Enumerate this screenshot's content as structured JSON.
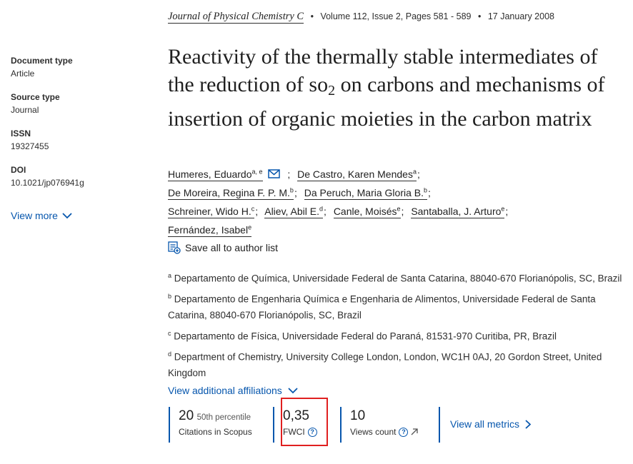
{
  "header": {
    "journal": "Journal of Physical Chemistry C",
    "volume_info": "Volume 112, Issue 2, Pages 581 - 589",
    "date": "17 January 2008",
    "separator": "•"
  },
  "sidebar": {
    "doc_type_label": "Document type",
    "doc_type_value": "Article",
    "source_type_label": "Source type",
    "source_type_value": "Journal",
    "issn_label": "ISSN",
    "issn_value": "19327455",
    "doi_label": "DOI",
    "doi_value": "10.1021/jp076941g",
    "view_more": "View more"
  },
  "title": {
    "part1": "Reactivity of the thermally stable intermediates of the reduction of so",
    "sub": "2",
    "part2": " on carbons and mechanisms of insertion of organic moieties in the carbon matrix"
  },
  "authors": [
    {
      "name": "Humeres, Eduardo",
      "sup": "a, e",
      "email": true
    },
    {
      "name": "De Castro, Karen Mendes",
      "sup": "a"
    },
    {
      "name": "De Moreira, Regina F. P. M.",
      "sup": "b"
    },
    {
      "name": "Da Peruch, Maria Gloria B.",
      "sup": "b"
    },
    {
      "name": "Schreiner, Wido H.",
      "sup": "c"
    },
    {
      "name": "Aliev, Abil E.",
      "sup": "d"
    },
    {
      "name": "Canle, Moisés",
      "sup": "e"
    },
    {
      "name": "Santaballa, J. Arturo",
      "sup": "e"
    },
    {
      "name": "Fernández, Isabel",
      "sup": "e"
    }
  ],
  "author_separator": ";",
  "save_authors": "Save all to author list",
  "affiliations": [
    {
      "sup": "a",
      "text": "Departamento de Química, Universidade Federal de Santa Catarina, 88040-670 Florianópolis, SC, Brazil"
    },
    {
      "sup": "b",
      "text": "Departamento de Engenharia Química e Engenharia de Alimentos, Universidade Federal de Santa Catarina, 88040-670 Florianópolis, SC, Brazil"
    },
    {
      "sup": "c",
      "text": "Departamento de Física, Universidade Federal do Paraná, 81531-970 Curitiba, PR, Brazil"
    },
    {
      "sup": "d",
      "text": "Department of Chemistry, University College London, London, WC1H 0AJ, 20 Gordon Street, United Kingdom"
    }
  ],
  "view_affiliations": "View additional affiliations",
  "metrics": {
    "citations_num": "20",
    "citations_percentile": "50th percentile",
    "citations_label": "Citations in Scopus",
    "fwci_num": "0,35",
    "fwci_label": "FWCI",
    "views_num": "10",
    "views_label": "Views count",
    "view_all": "View all metrics"
  },
  "colors": {
    "link": "#0656ad",
    "highlight": "#e02020"
  }
}
